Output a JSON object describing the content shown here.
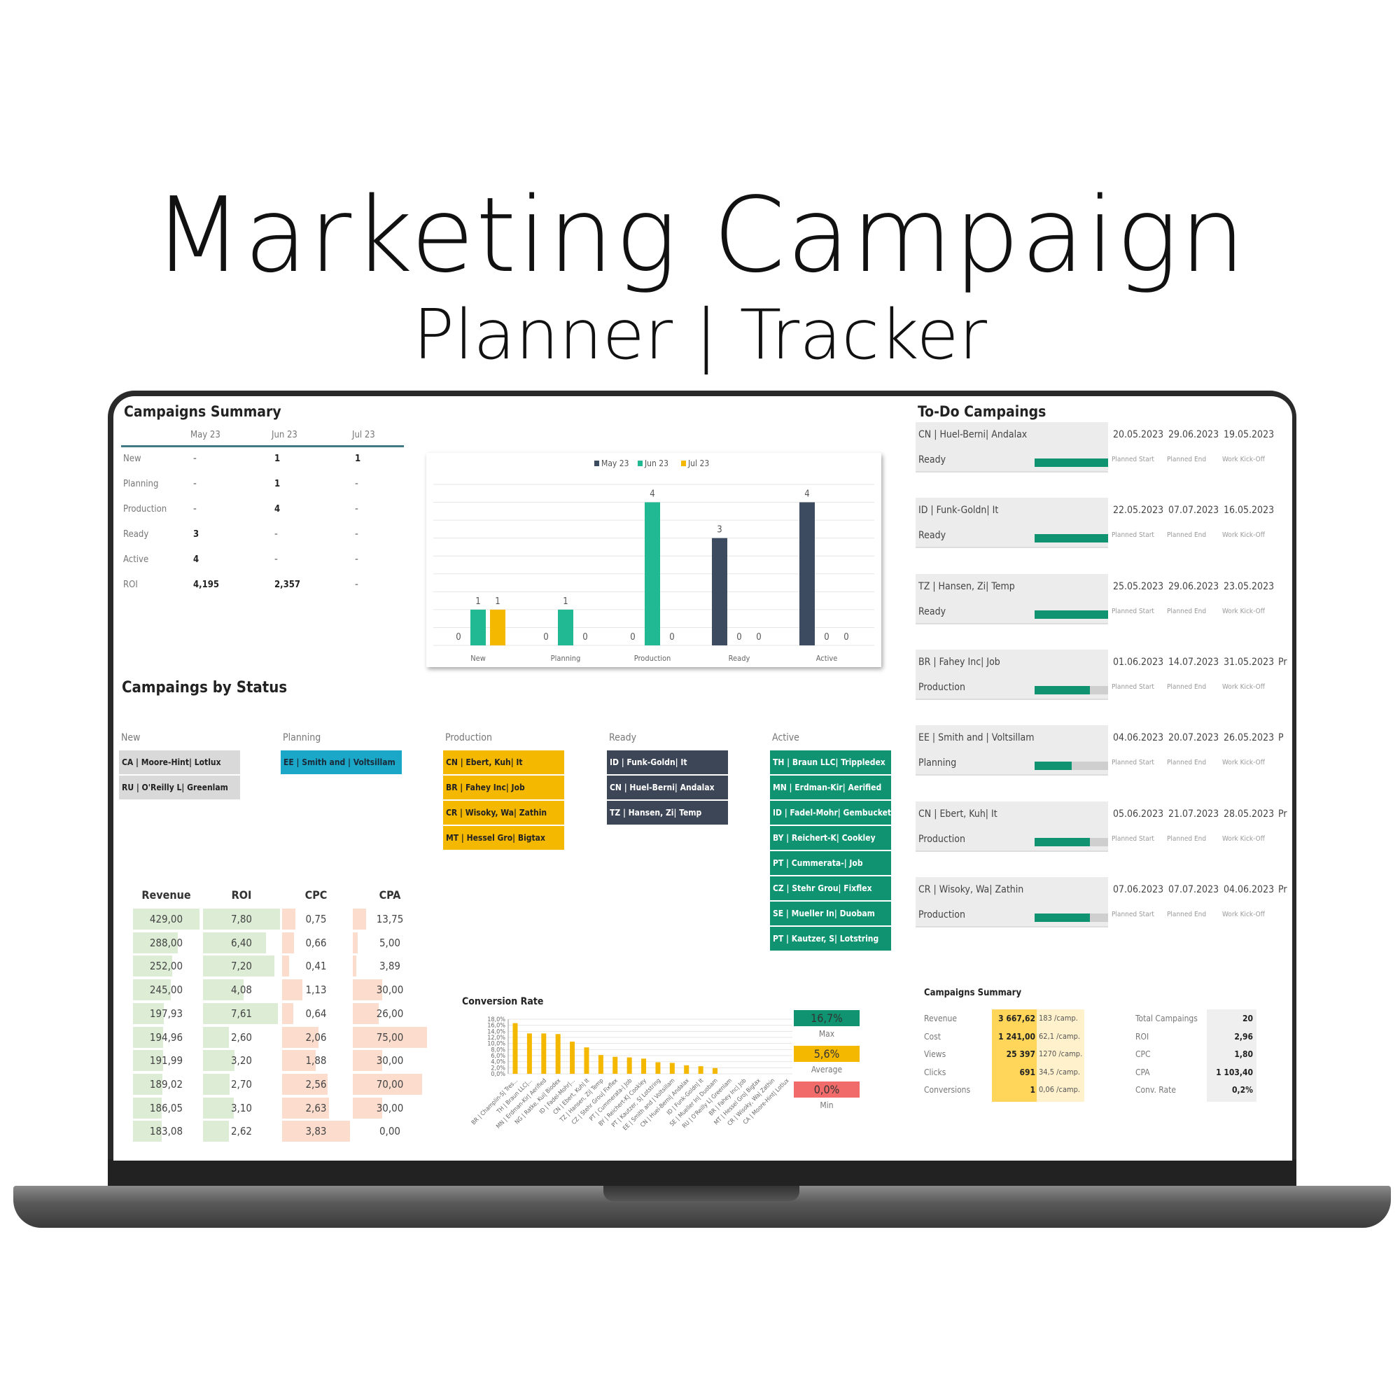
{
  "header": {
    "title": "Marketing Campaign",
    "subtitle": "Planner | Tracker"
  },
  "summary": {
    "title": "Campaigns Summary",
    "months": [
      "May 23",
      "Jun 23",
      "Jul 23"
    ],
    "rows": [
      {
        "label": "New",
        "values": [
          "-",
          "1",
          "1"
        ]
      },
      {
        "label": "Planning",
        "values": [
          "-",
          "1",
          "-"
        ]
      },
      {
        "label": "Production",
        "values": [
          "-",
          "4",
          "-"
        ]
      },
      {
        "label": "Ready",
        "values": [
          "3",
          "-",
          "-"
        ]
      },
      {
        "label": "Active",
        "values": [
          "4",
          "-",
          "-"
        ]
      },
      {
        "label": "ROI",
        "values": [
          "4,195",
          "2,357",
          "-"
        ]
      }
    ]
  },
  "chart_data": [
    {
      "type": "bar",
      "categories": [
        "New",
        "Planning",
        "Production",
        "Ready",
        "Active"
      ],
      "series": [
        {
          "name": "May 23",
          "color": "#3d4b61",
          "values": [
            0,
            0,
            0,
            3,
            4
          ]
        },
        {
          "name": "Jun 23",
          "color": "#20b994",
          "values": [
            1,
            1,
            4,
            0,
            0
          ]
        },
        {
          "name": "Jul 23",
          "color": "#f5b800",
          "values": [
            1,
            0,
            0,
            0,
            0
          ]
        }
      ],
      "ylim": [
        0,
        4.5
      ],
      "grid": true,
      "legend": "top"
    },
    {
      "type": "bar",
      "title": "Conversion Rate",
      "color": "#f5b800",
      "ylim": [
        0,
        18
      ],
      "yticks": [
        "0,0%",
        "2,0%",
        "4,0%",
        "6,0%",
        "8,0%",
        "10,0%",
        "12,0%",
        "14,0%",
        "16,0%",
        "18,0%"
      ],
      "grid": true,
      "categories": [
        "BR | Champlin-S| Tres...",
        "TH | Braun LLC|...",
        "MN | Erdman-Kir| Aerified",
        "NG | Ratke, Kui| Biodex",
        "ID | Fadel-Mohr|...",
        "CN | Ebert, Kuh| It",
        "TZ | Hansen, Zi| Temp",
        "CZ | Stehr Grou| Fixflex",
        "PT | Cummerata-| Job",
        "BY | Reichert-K| Cookley",
        "PT | Kautzer, S| Lotstring",
        "EE | Smith and | Voltsillam",
        "CN | Huel-Berni| Andalax",
        "ID | Funk-Goldn| It",
        "SE | Mueller In| Duobam",
        "RU | O'Reilly L| Greenlam",
        "BR | Fahey Inc| Job",
        "MT | Hessel Gro| Bigtax",
        "CR | Wisoky, Wa| Zathin",
        "CA | Moore-Hint| Lotlux"
      ],
      "values": [
        16.7,
        13.3,
        13.3,
        13.1,
        10.6,
        8.7,
        6.2,
        5.6,
        5.4,
        5.0,
        3.8,
        3.6,
        2.8,
        2.5,
        1.9,
        0,
        0,
        0,
        0,
        0
      ]
    }
  ],
  "kpi": [
    {
      "value": "16,7%",
      "label": "Max",
      "color": "#0f9370"
    },
    {
      "value": "5,6%",
      "label": "Average",
      "color": "#f5b800"
    },
    {
      "value": "0,0%",
      "label": "Min",
      "color": "#f26b6b"
    }
  ],
  "status": {
    "title": "Campaings by Status",
    "columns": [
      {
        "label": "New",
        "color": "#d9d9d9",
        "text": "#222",
        "items": [
          "CA | Moore-Hint| Lotlux",
          "RU | O'Reilly L| Greenlam"
        ]
      },
      {
        "label": "Planning",
        "color": "#1ba8c8",
        "text": "#1a2a3a",
        "items": [
          "EE | Smith and | Voltsillam"
        ]
      },
      {
        "label": "Production",
        "color": "#f5b800",
        "text": "#222",
        "items": [
          "CN | Ebert, Kuh| It",
          "BR | Fahey Inc| Job",
          "CR | Wisoky, Wa| Zathin",
          "MT | Hessel Gro| Bigtax"
        ]
      },
      {
        "label": "Ready",
        "color": "#3d4656",
        "text": "#fff",
        "items": [
          "ID | Funk-Goldn| It",
          "CN | Huel-Berni| Andalax",
          "TZ | Hansen, Zi| Temp"
        ]
      },
      {
        "label": "Active",
        "color": "#0f9370",
        "text": "#fff",
        "items": [
          "TH | Braun LLC| Trippledex",
          "MN | Erdman-Kir| Aerified",
          "ID | Fadel-Mohr| Gembucket",
          "BY | Reichert-K| Cookley",
          "PT | Cummerata-| Job",
          "CZ | Stehr Grou| Fixflex",
          "SE | Mueller In| Duobam",
          "PT | Kautzer, S| Lotstring"
        ]
      }
    ]
  },
  "metrics": {
    "headers": [
      "Revenue",
      "ROI",
      "CPC",
      "CPA"
    ],
    "rows": [
      [
        "429,00",
        "7,80",
        "0,75",
        "13,75"
      ],
      [
        "288,00",
        "6,40",
        "0,66",
        "5,00"
      ],
      [
        "252,00",
        "7,20",
        "0,41",
        "3,89"
      ],
      [
        "245,00",
        "4,08",
        "1,13",
        "30,00"
      ],
      [
        "197,93",
        "7,61",
        "0,64",
        "26,00"
      ],
      [
        "194,96",
        "2,60",
        "2,06",
        "75,00"
      ],
      [
        "191,99",
        "3,20",
        "1,88",
        "30,00"
      ],
      [
        "189,02",
        "2,70",
        "2,56",
        "70,00"
      ],
      [
        "186,05",
        "3,10",
        "2,63",
        "30,00"
      ],
      [
        "183,08",
        "2,62",
        "3,83",
        "0,00"
      ]
    ]
  },
  "todo": {
    "title": "To-Do Campaings",
    "date_labels": [
      "Planned Start",
      "Planned End",
      "Work Kick-Off"
    ],
    "items": [
      {
        "name": "CN | Huel-Berni| Andalax",
        "status": "Ready",
        "progress": 1.0,
        "dates": [
          "20.05.2023",
          "29.06.2023",
          "19.05.2023"
        ],
        "extra": ""
      },
      {
        "name": "ID | Funk-Goldn| It",
        "status": "Ready",
        "progress": 1.0,
        "dates": [
          "22.05.2023",
          "07.07.2023",
          "16.05.2023"
        ],
        "extra": ""
      },
      {
        "name": "TZ | Hansen, Zi| Temp",
        "status": "Ready",
        "progress": 1.0,
        "dates": [
          "25.05.2023",
          "29.06.2023",
          "23.05.2023"
        ],
        "extra": ""
      },
      {
        "name": "BR | Fahey Inc| Job",
        "status": "Production",
        "progress": 0.75,
        "dates": [
          "01.06.2023",
          "14.07.2023",
          "31.05.2023"
        ],
        "extra": "Pr"
      },
      {
        "name": "EE | Smith and | Voltsillam",
        "status": "Planning",
        "progress": 0.5,
        "dates": [
          "04.06.2023",
          "20.07.2023",
          "26.05.2023"
        ],
        "extra": "P"
      },
      {
        "name": "CN | Ebert, Kuh| It",
        "status": "Production",
        "progress": 0.75,
        "dates": [
          "05.06.2023",
          "21.07.2023",
          "28.05.2023"
        ],
        "extra": "Pr"
      },
      {
        "name": "CR | Wisoky, Wa| Zathin",
        "status": "Production",
        "progress": 0.75,
        "dates": [
          "07.06.2023",
          "07.07.2023",
          "04.06.2023"
        ],
        "extra": "Pr"
      }
    ]
  },
  "totals": {
    "title": "Campaigns Summary",
    "left": [
      {
        "label": "Revenue",
        "value": "3 667,62",
        "per": "183 /camp."
      },
      {
        "label": "Cost",
        "value": "1 241,00",
        "per": "62,1 /camp."
      },
      {
        "label": "Views",
        "value": "25 397",
        "per": "1270 /camp."
      },
      {
        "label": "Clicks",
        "value": "691",
        "per": "34,5 /camp."
      },
      {
        "label": "Conversions",
        "value": "1",
        "per": "0,06 /camp."
      }
    ],
    "right": [
      {
        "label": "Total Campaings",
        "value": "20"
      },
      {
        "label": "ROI",
        "value": "2,96"
      },
      {
        "label": "CPC",
        "value": "1,80"
      },
      {
        "label": "CPA",
        "value": "1 103,40"
      },
      {
        "label": "Conv. Rate",
        "value": "0,2%"
      }
    ]
  }
}
